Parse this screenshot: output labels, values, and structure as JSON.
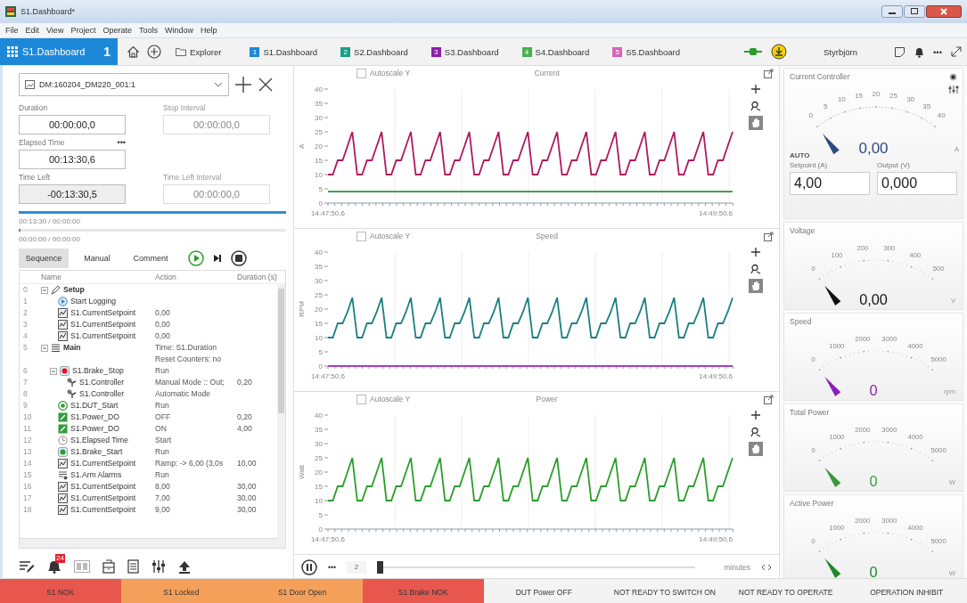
{
  "window": {
    "title": "S1.Dashboard*"
  },
  "menu": [
    "File",
    "Edit",
    "View",
    "Project",
    "Operate",
    "Tools",
    "Window",
    "Help"
  ],
  "toolbar": {
    "main_tab": {
      "label": "S1.Dashboard",
      "count": "1",
      "selected": true
    },
    "explorer": "Explorer",
    "dashboards": [
      {
        "number": "1",
        "label": "S1.Dashboard",
        "color": "#1e88d8"
      },
      {
        "number": "2",
        "label": "S2.Dashboard",
        "color": "#17a08a"
      },
      {
        "number": "3",
        "label": "S3.Dashboard",
        "color": "#8b1fa8"
      },
      {
        "number": "4",
        "label": "S4.Dashboard",
        "color": "#4caf50"
      },
      {
        "number": "5",
        "label": "S5.Dashboard",
        "color": "#d864b8"
      }
    ],
    "user": "Styrbjörn",
    "more": "•••"
  },
  "channel_picker": {
    "value": "DM:160204_DM220_001:1"
  },
  "timing": [
    [
      {
        "label": "Duration",
        "value": "00:00:00,0",
        "disabled": false,
        "readonly": false
      },
      {
        "label": "Stop Interval",
        "value": "00:00:00,0",
        "disabled": true,
        "readonly": false
      }
    ],
    [
      {
        "label": "Elapsed Time",
        "value": "00:13:30,6",
        "disabled": false,
        "readonly": false,
        "menu": "•••"
      }
    ],
    [
      {
        "label": "Time Left",
        "value": "-00:13:30,5",
        "disabled": false,
        "readonly": true
      },
      {
        "label": "Time Left Interval",
        "value": "00:00:00,0",
        "disabled": true,
        "readonly": false
      }
    ]
  ],
  "progress": [
    {
      "level": 1,
      "text": "00:13:30 / 00:00:00"
    },
    {
      "level": 0,
      "text": "00:00:00 / 00:00:00"
    }
  ],
  "tabs": [
    {
      "label": "Sequence",
      "selected": true
    },
    {
      "label": "Manual",
      "selected": false
    },
    {
      "label": "Comment",
      "selected": false
    }
  ],
  "sequence": {
    "columns": [
      "Name",
      "Action",
      "Duration (s)"
    ],
    "rows": [
      {
        "index": "0",
        "name": "Setup",
        "kind": "setup",
        "expanded": true,
        "children": [
          {
            "index": "1",
            "name": "Start Logging",
            "kind": "start-logging"
          },
          {
            "index": "2",
            "name": "S1.CurrentSetpoint",
            "kind": "setpoint",
            "action": "0,00"
          },
          {
            "index": "3",
            "name": "S1.CurrentSetpoint",
            "kind": "setpoint",
            "action": "0,00"
          },
          {
            "index": "4",
            "name": "S1.CurrentSetpoint",
            "kind": "setpoint",
            "action": "0,00"
          }
        ]
      },
      {
        "index": "5",
        "name": "Main",
        "kind": "main",
        "expanded": true,
        "action": "Time: S1.Duration\nReset Counters: no",
        "children": [
          {
            "index": "6",
            "name": "S1.Brake_Stop",
            "kind": "brake-stop",
            "action": "Run",
            "expanded": true,
            "children": [
              {
                "index": "7",
                "name": "S1.Controller",
                "kind": "controller",
                "action": "Manual Mode :: Out;",
                "duration": "0,20"
              },
              {
                "index": "8",
                "name": "S1.Controller",
                "kind": "controller",
                "action": "Automatic Mode"
              }
            ]
          },
          {
            "index": "9",
            "name": "S1.DUT_Start",
            "kind": "dut-start",
            "action": "Run"
          },
          {
            "index": "10",
            "name": "S1.Power_DO",
            "kind": "power",
            "action": "OFF",
            "duration": "0,20"
          },
          {
            "index": "11",
            "name": "S1.Power_DO",
            "kind": "power",
            "action": "ON",
            "duration": "4,00"
          },
          {
            "index": "12",
            "name": "S1.Elapsed Time",
            "kind": "timer",
            "action": "Start"
          },
          {
            "index": "13",
            "name": "S1.Brake_Start",
            "kind": "brake-start",
            "action": "Run"
          },
          {
            "index": "14",
            "name": "S1.CurrentSetpoint",
            "kind": "setpoint",
            "action": "Ramp: -> 6,00 (3,0s",
            "duration": "10,00"
          },
          {
            "index": "15",
            "name": "S1.Arm Alarms",
            "kind": "alarms",
            "action": "Run"
          },
          {
            "index": "16",
            "name": "S1.CurrentSetpoint",
            "kind": "setpoint",
            "action": "8,00",
            "duration": "30,00"
          },
          {
            "index": "17",
            "name": "S1.CurrentSetpoint",
            "kind": "setpoint",
            "action": "7,00",
            "duration": "30,00"
          },
          {
            "index": "18",
            "name": "S1.CurrentSetpoint",
            "kind": "setpoint",
            "action": "9,00",
            "duration": "30,00"
          }
        ]
      }
    ]
  },
  "bottom_tools": {
    "alarm_count": "24"
  },
  "charts": [
    {
      "time_start": "14:47:50,6",
      "time_end": "14:49:50,6",
      "autoscale": {
        "label": "Autoscale Y",
        "checked": false
      },
      "tools": [
        {
          "kind": "add",
          "selected": false
        },
        {
          "kind": "zoom",
          "selected": false
        },
        {
          "kind": "pan",
          "selected": true
        }
      ],
      "chart_data": {
        "type": "line",
        "title": "Current",
        "ylabel": "A",
        "ylim": [
          0,
          40
        ],
        "yticks": [
          0,
          5,
          10,
          15,
          20,
          25,
          30,
          35,
          40
        ],
        "series": [
          {
            "color": "#b0185e",
            "values": [
              10,
              10,
              15,
              15,
              20,
              25,
              10,
              10,
              15,
              15,
              20,
              25,
              10,
              10,
              15,
              15,
              20,
              25,
              10,
              10,
              15,
              15,
              20,
              25,
              10,
              10,
              15,
              15,
              20,
              25,
              10,
              10,
              15,
              15,
              20,
              25,
              10,
              10,
              15,
              15,
              20,
              25,
              10,
              10,
              15,
              15,
              20,
              25,
              10,
              10,
              15,
              15,
              20,
              25,
              10,
              10,
              15,
              15,
              20,
              25,
              10,
              10,
              15,
              15,
              20,
              25,
              10,
              10,
              15,
              15,
              20,
              25,
              10,
              10,
              15,
              15,
              20,
              25,
              10,
              10,
              15,
              15,
              20,
              25
            ]
          },
          {
            "color": "#2f8f3a",
            "values": [
              4,
              4,
              4,
              4,
              4,
              4,
              4,
              4,
              4,
              4,
              4,
              4,
              4,
              4,
              4,
              4,
              4,
              4,
              4,
              4,
              4,
              4,
              4,
              4,
              4,
              4,
              4,
              4,
              4,
              4,
              4,
              4,
              4,
              4,
              4,
              4,
              4,
              4,
              4,
              4,
              4,
              4,
              4,
              4,
              4,
              4,
              4,
              4,
              4,
              4,
              4,
              4,
              4,
              4,
              4,
              4,
              4,
              4,
              4,
              4,
              4,
              4,
              4,
              4,
              4,
              4,
              4,
              4,
              4,
              4,
              4,
              4,
              4,
              4,
              4,
              4,
              4,
              4,
              4,
              4,
              4,
              4,
              4,
              4
            ]
          }
        ]
      }
    },
    {
      "time_start": "14:47:50,6",
      "time_end": "14:49:50,6",
      "autoscale": {
        "label": "Autoscale Y",
        "checked": false
      },
      "tools": [
        {
          "kind": "add",
          "selected": false
        },
        {
          "kind": "zoom",
          "selected": false
        },
        {
          "kind": "pan",
          "selected": true
        }
      ],
      "chart_data": {
        "type": "line",
        "title": "Speed",
        "ylabel": "RPM",
        "ylim": [
          0,
          40
        ],
        "yticks": [
          0,
          5,
          10,
          15,
          20,
          25,
          30,
          35,
          40
        ],
        "series": [
          {
            "color": "#1a7f80",
            "values": [
              10,
              10,
              15,
              15,
              19,
              24,
              10,
              10,
              15,
              15,
              19,
              24,
              10,
              10,
              15,
              15,
              19,
              24,
              10,
              10,
              15,
              15,
              19,
              24,
              10,
              10,
              15,
              15,
              19,
              24,
              10,
              10,
              15,
              15,
              19,
              24,
              10,
              10,
              15,
              15,
              19,
              24,
              10,
              10,
              15,
              15,
              19,
              24,
              10,
              10,
              15,
              15,
              19,
              24,
              10,
              10,
              15,
              15,
              19,
              24,
              10,
              10,
              15,
              15,
              19,
              24,
              10,
              10,
              15,
              15,
              19,
              24,
              10,
              10,
              15,
              15,
              19,
              24,
              10,
              10,
              15,
              15,
              19,
              24
            ]
          },
          {
            "color": "#a040c0",
            "values": [
              0,
              0,
              0,
              0,
              0,
              0,
              0,
              0,
              0,
              0,
              0,
              0,
              0,
              0,
              0,
              0,
              0,
              0,
              0,
              0,
              0,
              0,
              0,
              0,
              0,
              0,
              0,
              0,
              0,
              0,
              0,
              0,
              0,
              0,
              0,
              0,
              0,
              0,
              0,
              0,
              0,
              0,
              0,
              0,
              0,
              0,
              0,
              0,
              0,
              0,
              0,
              0,
              0,
              0,
              0,
              0,
              0,
              0,
              0,
              0,
              0,
              0,
              0,
              0,
              0,
              0,
              0,
              0,
              0,
              0,
              0,
              0,
              0,
              0,
              0,
              0,
              0,
              0,
              0,
              0,
              0,
              0,
              0,
              0
            ]
          }
        ]
      }
    },
    {
      "time_start": "14:47:50,6",
      "time_end": "14:49:50,6",
      "autoscale": {
        "label": "Autoscale Y",
        "checked": false
      },
      "tools": [
        {
          "kind": "add",
          "selected": false
        },
        {
          "kind": "zoom",
          "selected": false
        },
        {
          "kind": "pan",
          "selected": true
        }
      ],
      "chart_data": {
        "type": "line",
        "title": "Power",
        "ylabel": "Watt",
        "ylim": [
          0,
          40
        ],
        "yticks": [
          0,
          5,
          10,
          15,
          20,
          25,
          30,
          35,
          40
        ],
        "series": [
          {
            "color": "#2a9d2a",
            "values": [
              10,
              10,
              15,
              15,
              20,
              25,
              10,
              10,
              15,
              15,
              20,
              25,
              10,
              10,
              15,
              15,
              20,
              25,
              10,
              10,
              15,
              15,
              20,
              25,
              10,
              10,
              15,
              15,
              20,
              25,
              10,
              10,
              15,
              15,
              20,
              25,
              10,
              10,
              15,
              15,
              20,
              25,
              10,
              10,
              15,
              15,
              20,
              25,
              10,
              10,
              15,
              15,
              20,
              25,
              10,
              10,
              15,
              15,
              20,
              25,
              10,
              10,
              15,
              15,
              20,
              25,
              10,
              10,
              15,
              15,
              20,
              25,
              10,
              10,
              15,
              15,
              20,
              25,
              10,
              10,
              15,
              15,
              20,
              25
            ]
          }
        ]
      }
    }
  ],
  "playback": {
    "menu": "•••",
    "window": "2",
    "level": 0,
    "unit": "minutes"
  },
  "gauges": [
    {
      "title": "Current Controller",
      "ticks": [
        "0",
        "5",
        "10",
        "15",
        "20",
        "25",
        "30",
        "35",
        "40"
      ],
      "value": "0,00",
      "unit": "A",
      "color": "#2c4a86",
      "mode": "AUTO",
      "fields": [
        {
          "label": "Setpoint (A)",
          "value": "4,00"
        },
        {
          "label": "Output (V)",
          "value": "0,000"
        }
      ]
    },
    {
      "title": "Voltage",
      "ticks": [
        "0",
        "100",
        "200",
        "300",
        "400",
        "500"
      ],
      "value": "0,00",
      "unit": "V",
      "color": "#111111"
    },
    {
      "title": "Speed",
      "ticks": [
        "0",
        "1000",
        "2000",
        "3000",
        "4000",
        "5000"
      ],
      "value": "0",
      "unit": "rpm",
      "color": "#8a1fb8"
    },
    {
      "title": "Total Power",
      "ticks": [
        "0",
        "1000",
        "2000",
        "3000",
        "4000",
        "5000"
      ],
      "value": "0",
      "unit": "W",
      "color": "#3a9a3a"
    },
    {
      "title": "Active Power",
      "ticks": [
        "0",
        "1000",
        "2000",
        "3000",
        "4000",
        "5000"
      ],
      "value": "0",
      "unit": "W",
      "color": "#1c8a2c"
    }
  ],
  "status": [
    {
      "label": "S1 NOK",
      "color": "#e8574e"
    },
    {
      "label": "S1 Locked",
      "color": "#f5a05a"
    },
    {
      "label": "S1 Door Open",
      "color": "#f5a05a"
    },
    {
      "label": "S1 Brake NOK",
      "color": "#e8574e"
    },
    {
      "label": "DUT Power OFF",
      "color": "#f3f3f3"
    },
    {
      "label": "NOT READY TO SWITCH ON",
      "color": "#f3f3f3"
    },
    {
      "label": "NOT READY TO OPERATE",
      "color": "#f3f3f3"
    },
    {
      "label": "OPERATION INHIBIT",
      "color": "#f3f3f3"
    }
  ]
}
